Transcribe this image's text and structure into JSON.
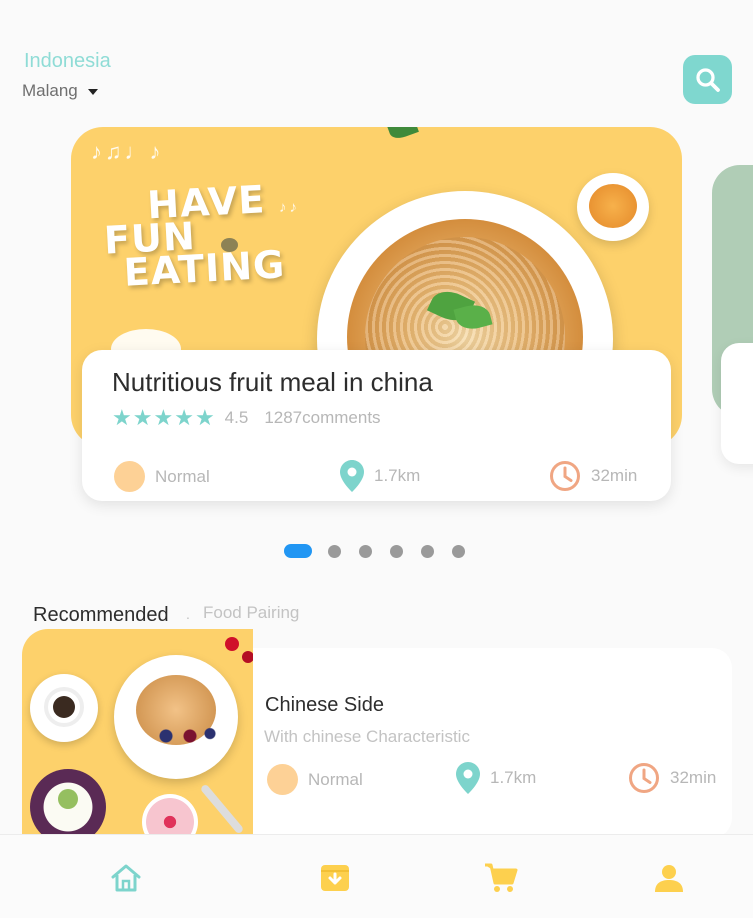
{
  "location": {
    "country": "Indonesia",
    "city": "Malang"
  },
  "colors": {
    "teal": "#7fd7cf",
    "yellow": "#fdd16b",
    "orange": "#f0a683",
    "active_dot": "#2196f3"
  },
  "banner": {
    "text_lines": [
      "HAVE",
      "FUN",
      "EATING"
    ]
  },
  "featured": {
    "title": "Nutritious fruit meal in china",
    "star_count": 5,
    "rating": "4.5",
    "comments": "1287comments",
    "level": "Normal",
    "distance": "1.7km",
    "time": "32min"
  },
  "pager": {
    "count": 6,
    "active_index": 0
  },
  "section": {
    "title": "Recommended",
    "separator": ".",
    "subtitle": "Food Pairing"
  },
  "recommended": {
    "title": "Chinese Side",
    "subtitle": "With chinese Characteristic",
    "level": "Normal",
    "distance": "1.7km",
    "time": "32min"
  },
  "tabs": [
    {
      "icon": "home-icon",
      "active": true
    },
    {
      "icon": "archive-icon",
      "active": false
    },
    {
      "icon": "cart-icon",
      "active": false
    },
    {
      "icon": "profile-icon",
      "active": false
    }
  ]
}
